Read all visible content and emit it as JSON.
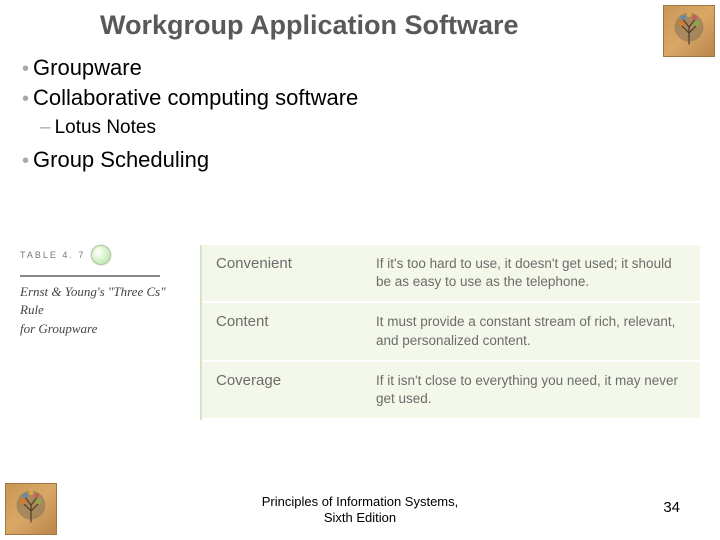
{
  "title": "Workgroup Application Software",
  "bullets": {
    "item1": "Groupware",
    "item2": "Collaborative computing software",
    "sub1": "Lotus Notes",
    "item3": "Group Scheduling"
  },
  "table": {
    "label_top": "TABLE 4. 7",
    "label_caption_line1": "Ernst & Young's \"Three Cs\" Rule",
    "label_caption_line2": "for Groupware",
    "rows": [
      {
        "term": "Convenient",
        "desc": "If it's too hard to use, it doesn't get used; it should be as easy to use as the telephone."
      },
      {
        "term": "Content",
        "desc": "It must provide a constant stream of rich, relevant, and personalized content."
      },
      {
        "term": "Coverage",
        "desc": "If it isn't close to everything you need, it may never get used."
      }
    ]
  },
  "footer": {
    "line1": "Principles of Information Systems,",
    "line2": "Sixth Edition",
    "page": "34"
  }
}
